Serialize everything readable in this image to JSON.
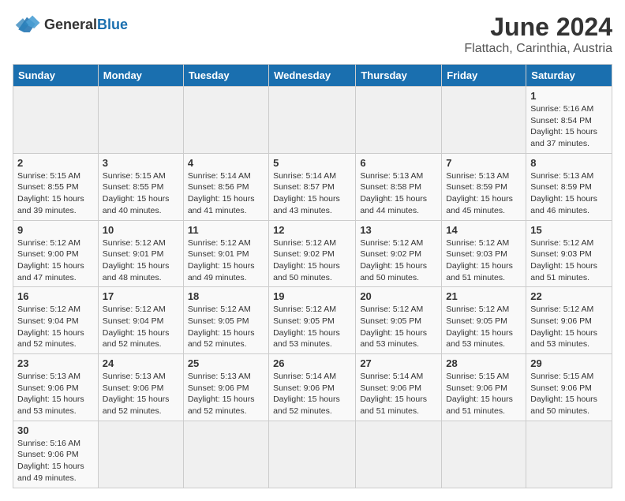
{
  "header": {
    "logo_general": "General",
    "logo_blue": "Blue",
    "title": "June 2024",
    "subtitle": "Flattach, Carinthia, Austria"
  },
  "weekdays": [
    "Sunday",
    "Monday",
    "Tuesday",
    "Wednesday",
    "Thursday",
    "Friday",
    "Saturday"
  ],
  "days": [
    {
      "date": "",
      "info": ""
    },
    {
      "date": "",
      "info": ""
    },
    {
      "date": "",
      "info": ""
    },
    {
      "date": "",
      "info": ""
    },
    {
      "date": "",
      "info": ""
    },
    {
      "date": "",
      "info": ""
    },
    {
      "date": "1",
      "info": "Sunrise: 5:16 AM\nSunset: 8:54 PM\nDaylight: 15 hours\nand 37 minutes."
    },
    {
      "date": "2",
      "info": "Sunrise: 5:15 AM\nSunset: 8:55 PM\nDaylight: 15 hours\nand 39 minutes."
    },
    {
      "date": "3",
      "info": "Sunrise: 5:15 AM\nSunset: 8:55 PM\nDaylight: 15 hours\nand 40 minutes."
    },
    {
      "date": "4",
      "info": "Sunrise: 5:14 AM\nSunset: 8:56 PM\nDaylight: 15 hours\nand 41 minutes."
    },
    {
      "date": "5",
      "info": "Sunrise: 5:14 AM\nSunset: 8:57 PM\nDaylight: 15 hours\nand 43 minutes."
    },
    {
      "date": "6",
      "info": "Sunrise: 5:13 AM\nSunset: 8:58 PM\nDaylight: 15 hours\nand 44 minutes."
    },
    {
      "date": "7",
      "info": "Sunrise: 5:13 AM\nSunset: 8:59 PM\nDaylight: 15 hours\nand 45 minutes."
    },
    {
      "date": "8",
      "info": "Sunrise: 5:13 AM\nSunset: 8:59 PM\nDaylight: 15 hours\nand 46 minutes."
    },
    {
      "date": "9",
      "info": "Sunrise: 5:12 AM\nSunset: 9:00 PM\nDaylight: 15 hours\nand 47 minutes."
    },
    {
      "date": "10",
      "info": "Sunrise: 5:12 AM\nSunset: 9:01 PM\nDaylight: 15 hours\nand 48 minutes."
    },
    {
      "date": "11",
      "info": "Sunrise: 5:12 AM\nSunset: 9:01 PM\nDaylight: 15 hours\nand 49 minutes."
    },
    {
      "date": "12",
      "info": "Sunrise: 5:12 AM\nSunset: 9:02 PM\nDaylight: 15 hours\nand 50 minutes."
    },
    {
      "date": "13",
      "info": "Sunrise: 5:12 AM\nSunset: 9:02 PM\nDaylight: 15 hours\nand 50 minutes."
    },
    {
      "date": "14",
      "info": "Sunrise: 5:12 AM\nSunset: 9:03 PM\nDaylight: 15 hours\nand 51 minutes."
    },
    {
      "date": "15",
      "info": "Sunrise: 5:12 AM\nSunset: 9:03 PM\nDaylight: 15 hours\nand 51 minutes."
    },
    {
      "date": "16",
      "info": "Sunrise: 5:12 AM\nSunset: 9:04 PM\nDaylight: 15 hours\nand 52 minutes."
    },
    {
      "date": "17",
      "info": "Sunrise: 5:12 AM\nSunset: 9:04 PM\nDaylight: 15 hours\nand 52 minutes."
    },
    {
      "date": "18",
      "info": "Sunrise: 5:12 AM\nSunset: 9:05 PM\nDaylight: 15 hours\nand 52 minutes."
    },
    {
      "date": "19",
      "info": "Sunrise: 5:12 AM\nSunset: 9:05 PM\nDaylight: 15 hours\nand 53 minutes."
    },
    {
      "date": "20",
      "info": "Sunrise: 5:12 AM\nSunset: 9:05 PM\nDaylight: 15 hours\nand 53 minutes."
    },
    {
      "date": "21",
      "info": "Sunrise: 5:12 AM\nSunset: 9:05 PM\nDaylight: 15 hours\nand 53 minutes."
    },
    {
      "date": "22",
      "info": "Sunrise: 5:12 AM\nSunset: 9:06 PM\nDaylight: 15 hours\nand 53 minutes."
    },
    {
      "date": "23",
      "info": "Sunrise: 5:13 AM\nSunset: 9:06 PM\nDaylight: 15 hours\nand 53 minutes."
    },
    {
      "date": "24",
      "info": "Sunrise: 5:13 AM\nSunset: 9:06 PM\nDaylight: 15 hours\nand 52 minutes."
    },
    {
      "date": "25",
      "info": "Sunrise: 5:13 AM\nSunset: 9:06 PM\nDaylight: 15 hours\nand 52 minutes."
    },
    {
      "date": "26",
      "info": "Sunrise: 5:14 AM\nSunset: 9:06 PM\nDaylight: 15 hours\nand 52 minutes."
    },
    {
      "date": "27",
      "info": "Sunrise: 5:14 AM\nSunset: 9:06 PM\nDaylight: 15 hours\nand 51 minutes."
    },
    {
      "date": "28",
      "info": "Sunrise: 5:15 AM\nSunset: 9:06 PM\nDaylight: 15 hours\nand 51 minutes."
    },
    {
      "date": "29",
      "info": "Sunrise: 5:15 AM\nSunset: 9:06 PM\nDaylight: 15 hours\nand 50 minutes."
    },
    {
      "date": "30",
      "info": "Sunrise: 5:16 AM\nSunset: 9:06 PM\nDaylight: 15 hours\nand 49 minutes."
    },
    {
      "date": "",
      "info": ""
    },
    {
      "date": "",
      "info": ""
    },
    {
      "date": "",
      "info": ""
    },
    {
      "date": "",
      "info": ""
    },
    {
      "date": "",
      "info": ""
    },
    {
      "date": "",
      "info": ""
    }
  ]
}
